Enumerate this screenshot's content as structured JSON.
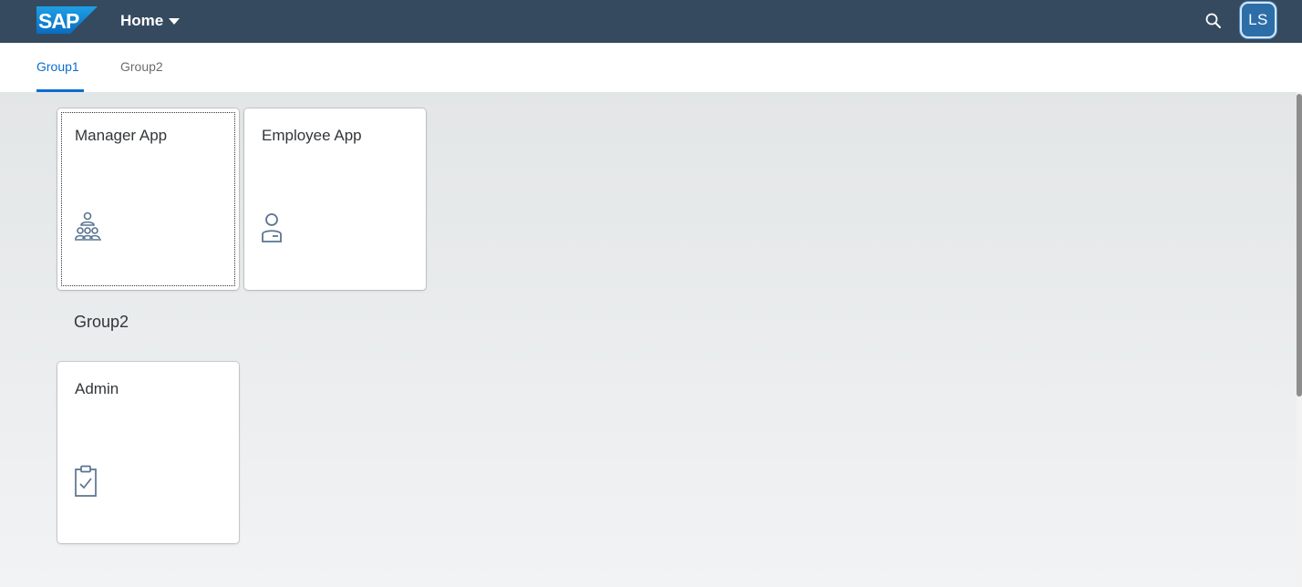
{
  "header": {
    "logo_text": "SAP",
    "title": "Home",
    "user_initials": "LS",
    "brand_color": "#354a5f",
    "accent_color": "#0a6ed1"
  },
  "anchors": [
    {
      "label": "Group1",
      "selected": true
    },
    {
      "label": "Group2",
      "selected": false
    }
  ],
  "groups": [
    {
      "title": "",
      "tiles": [
        {
          "title": "Manager App",
          "icon": "manager-group-icon"
        },
        {
          "title": "Employee App",
          "icon": "employee-icon"
        }
      ]
    },
    {
      "title": "Group2",
      "tiles": [
        {
          "title": "Admin",
          "icon": "clipboard-check-icon"
        }
      ]
    }
  ]
}
